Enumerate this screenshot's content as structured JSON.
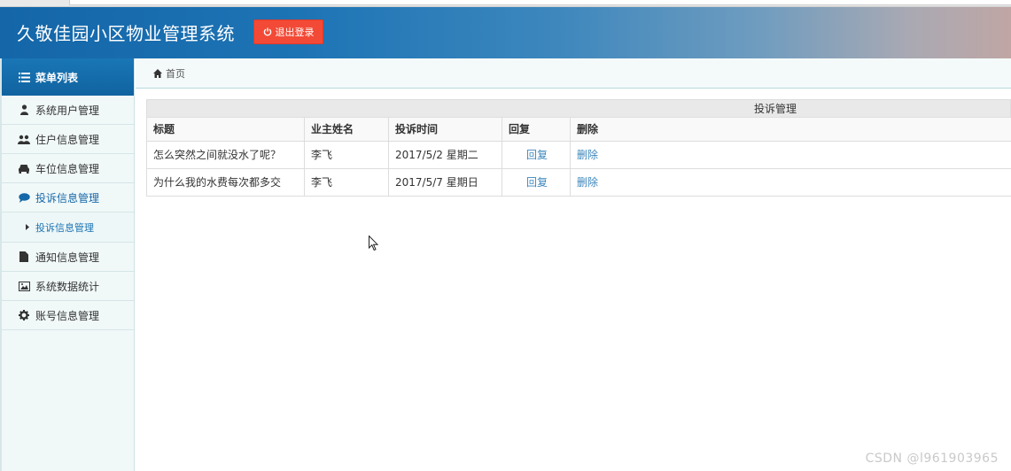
{
  "header": {
    "title": "久敬佳园小区物业管理系统",
    "logout_label": "退出登录"
  },
  "sidebar": {
    "menu_title": "菜单列表",
    "items": [
      {
        "label": "系统用户管理",
        "icon": "user-icon"
      },
      {
        "label": "住户信息管理",
        "icon": "users-icon"
      },
      {
        "label": "车位信息管理",
        "icon": "car-icon"
      },
      {
        "label": "投诉信息管理",
        "icon": "comment-icon"
      },
      {
        "label": "投诉信息管理",
        "icon": "caret-right-icon"
      },
      {
        "label": "通知信息管理",
        "icon": "file-icon"
      },
      {
        "label": "系统数据统计",
        "icon": "image-icon"
      },
      {
        "label": "账号信息管理",
        "icon": "gear-icon"
      }
    ]
  },
  "breadcrumb": {
    "home_label": "首页"
  },
  "complaints": {
    "caption": "投诉管理",
    "columns": [
      "标题",
      "业主姓名",
      "投诉时间",
      "回复",
      "删除"
    ],
    "rows": [
      {
        "title": "怎么突然之间就没水了呢？",
        "owner": "李飞",
        "time": "2017/5/2 星期二",
        "reply": "回复",
        "delete": "删除"
      },
      {
        "title": "为什么我的水费每次都多交",
        "owner": "李飞",
        "time": "2017/5/7 星期日",
        "reply": "回复",
        "delete": "删除"
      }
    ]
  },
  "watermark": "CSDN @l961903965",
  "colors": {
    "header_blue": "#1466a8",
    "logout_red": "#f24a36",
    "link_blue": "#3d87bd"
  }
}
